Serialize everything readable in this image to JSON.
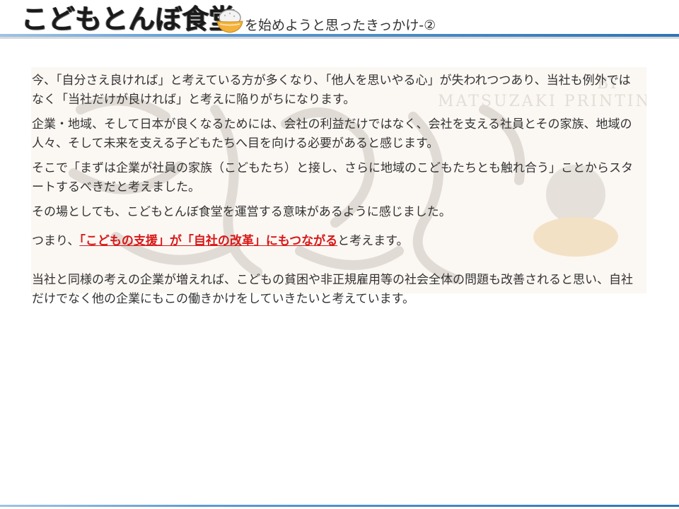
{
  "header": {
    "logo_text": "こどもとんぼ食堂",
    "subtitle": "を始めようと思ったきっかけ-②"
  },
  "body": {
    "p1": "今、「自分さえ良ければ」と考えている方が多くなり、「他人を思いやる心」が失われつつあり、当社も例外ではなく「当社だけが良ければ」と考えに陥りがちになります。",
    "p2": "企業・地域、そして日本が良くなるためには、会社の利益だけではなく、会社を支える社員とその家族、地域の人々、そして未来を支える子どもたちへ目を向ける必要があると感じます。",
    "p3": "そこで「まずは企業が社員の家族（こどもたち）と接し、さらに地域のこどもたちとも触れ合う」ことからスタートするべきだと考えました。",
    "p4": "その場としても、こどもとんぼ食堂を運営する意味があるように感じました。",
    "p5_prefix": "つまり、",
    "p5_highlight": "「こどもの支援」が「自社の改革」にもつながる",
    "p5_suffix": "と考えます。",
    "p6": "当社と同様の考えの企業が増えれば、こどもの貧困や非正規雇用等の社会全体の問題も改善されると思い、自社だけでなく他の企業にもこの働きかけをしていきたいと考えています。"
  },
  "colors": {
    "accent_red": "#d81818",
    "header_blue": "#5b9bd5"
  }
}
